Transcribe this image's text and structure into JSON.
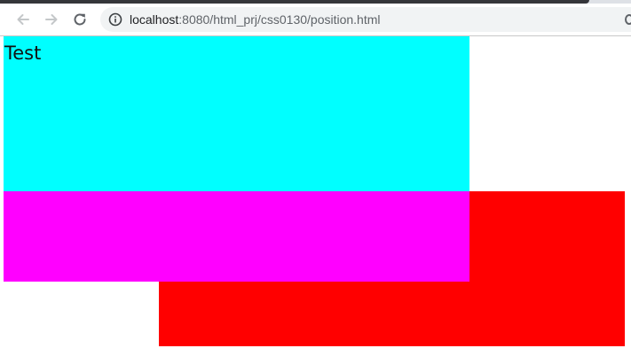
{
  "browser": {
    "url_host": "localhost",
    "url_path": ":8080/html_prj/css0130/position.html"
  },
  "page": {
    "boxes": [
      {
        "name": "cyan-box",
        "color": "#00ffff",
        "text": "Test"
      },
      {
        "name": "magenta-box",
        "color": "#ff00ff",
        "text": ""
      },
      {
        "name": "red-box",
        "color": "#ff0000",
        "text": ""
      }
    ]
  },
  "icons": [
    "back-arrow-icon",
    "forward-arrow-icon",
    "reload-icon",
    "info-icon"
  ]
}
